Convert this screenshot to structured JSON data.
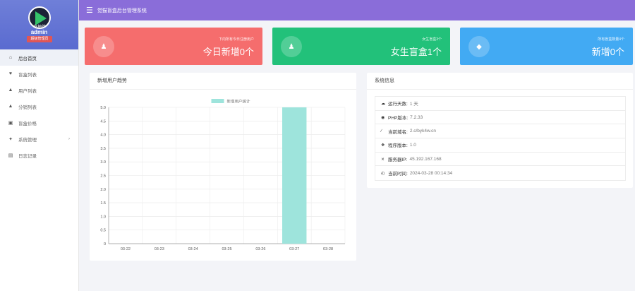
{
  "sidebar": {
    "logo_overlay": "来抽签",
    "admin_name": "admin",
    "role": "超级管理员",
    "items": [
      {
        "label": "后台首页",
        "icon": "home-icon",
        "glyph": "⌂",
        "active": true
      },
      {
        "label": "盲盒列表",
        "icon": "heart-icon",
        "glyph": "♥"
      },
      {
        "label": "用户列表",
        "icon": "user-icon",
        "glyph": "▲"
      },
      {
        "label": "分销列表",
        "icon": "user-icon",
        "glyph": "▲"
      },
      {
        "label": "盲盒价格",
        "icon": "calendar-icon",
        "glyph": "▣"
      },
      {
        "label": "系统管理",
        "icon": "settings-icon",
        "glyph": "✦",
        "has_children": true
      },
      {
        "label": "日志记录",
        "icon": "list-icon",
        "glyph": "▤"
      }
    ]
  },
  "header": {
    "menu_icon": "hamburger-icon",
    "title": "觉猫盲盒后台管理系统"
  },
  "cards": [
    {
      "subtitle": "下向所有今日注册用户",
      "value": "今日新增0个",
      "icon": "user-add-icon",
      "color": "#f56d6d"
    },
    {
      "subtitle": "女生盲盒3个",
      "value": "女生盲盒1个",
      "icon": "user-add-icon",
      "color": "#22c17a"
    },
    {
      "subtitle": "所有盲盒数量4个",
      "value": "新增0个",
      "icon": "diamond-icon",
      "color": "#42aaf3"
    }
  ],
  "chart_panel": {
    "title": "新增用户趋势"
  },
  "chart_data": {
    "type": "bar",
    "categories": [
      "03-22",
      "03-23",
      "03-24",
      "03-25",
      "03-26",
      "03-27",
      "03-28"
    ],
    "series": [
      {
        "name": "新增用户统计",
        "values": [
          0,
          0,
          0,
          0,
          0,
          5,
          0
        ]
      }
    ],
    "ylim": [
      0,
      5
    ],
    "yticks": [
      "0",
      "0.5",
      "1.0",
      "1.5",
      "2.0",
      "2.5",
      "3.0",
      "3.5",
      "4.0",
      "4.5",
      "5.0"
    ],
    "legend": "top-center",
    "grid": true,
    "bar_color": "#9ee4dc"
  },
  "info_panel": {
    "title": "系统信息",
    "rows": [
      {
        "icon": "cloud-icon",
        "glyph": "☁",
        "label": "运行天数:",
        "value": "1 天"
      },
      {
        "icon": "eye-icon",
        "glyph": "◉",
        "label": "PHP版本:",
        "value": "7.2.33"
      },
      {
        "icon": "link-icon",
        "glyph": "∕",
        "label": "当前域名:",
        "value": "2.c/byk4w.cn"
      },
      {
        "icon": "database-icon",
        "glyph": "❖",
        "label": "程序版本:",
        "value": "1.0"
      },
      {
        "icon": "shuffle-icon",
        "glyph": "⨯",
        "label": "服务器IP:",
        "value": "45.192.167.168"
      },
      {
        "icon": "clock-icon",
        "glyph": "◴",
        "label": "当前时间:",
        "value": "2024-03-28 00:14:34"
      }
    ]
  }
}
